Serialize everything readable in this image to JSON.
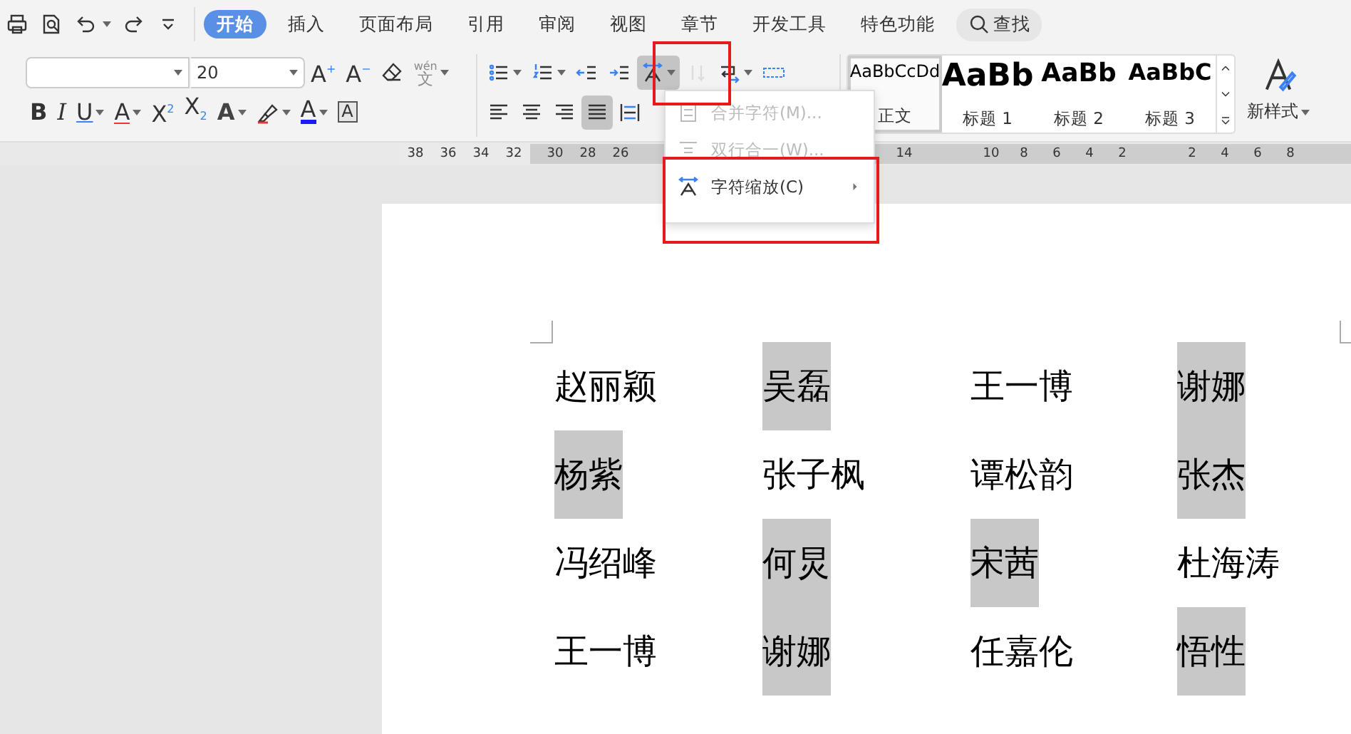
{
  "quick_access": [
    {
      "kind": "print",
      "caret": false
    },
    {
      "kind": "preview",
      "caret": false
    },
    {
      "kind": "undo",
      "caret": true
    },
    {
      "kind": "redo",
      "caret": false
    },
    {
      "kind": "more",
      "caret": false
    }
  ],
  "tabs": [
    {
      "label": "开始",
      "selected": true
    },
    {
      "label": "插入",
      "selected": false
    },
    {
      "label": "页面布局",
      "selected": false
    },
    {
      "label": "引用",
      "selected": false
    },
    {
      "label": "审阅",
      "selected": false
    },
    {
      "label": "视图",
      "selected": false
    },
    {
      "label": "章节",
      "selected": false
    },
    {
      "label": "开发工具",
      "selected": false
    },
    {
      "label": "特色功能",
      "selected": false
    }
  ],
  "search": {
    "label": "查找"
  },
  "ribbon": {
    "font_size": {
      "value": "20"
    },
    "font_row_tools": [
      {
        "kind": "grow",
        "label": "A",
        "mark": "+",
        "caret": false,
        "pressed": false,
        "disabled": false
      },
      {
        "kind": "shrink",
        "label": "A",
        "mark": "−",
        "caret": false,
        "pressed": false,
        "disabled": false
      },
      {
        "kind": "eraser",
        "caret": false,
        "pressed": false,
        "disabled": false
      },
      {
        "kind": "pinyin",
        "label": "文",
        "mark": "wén",
        "caret": true,
        "pressed": false,
        "disabled": true
      }
    ],
    "format_row_tools": [
      {
        "kind": "bold",
        "label": "B",
        "caret": false,
        "pressed": false,
        "disabled": false
      },
      {
        "kind": "italic",
        "label": "I",
        "caret": false,
        "pressed": false,
        "disabled": false
      },
      {
        "kind": "underline",
        "label": "U",
        "caret": true,
        "pressed": false,
        "disabled": false
      },
      {
        "kind": "strike",
        "label": "A",
        "caret": true,
        "pressed": false,
        "disabled": false
      },
      {
        "kind": "superscript",
        "label": "X",
        "mark": "2",
        "caret": false,
        "pressed": false,
        "disabled": false
      },
      {
        "kind": "subscript",
        "label": "X",
        "mark": "2",
        "caret": false,
        "pressed": false,
        "disabled": false
      },
      {
        "kind": "outline",
        "label": "A",
        "caret": true,
        "pressed": false,
        "disabled": false
      },
      {
        "kind": "highlighter",
        "caret": true,
        "pressed": false,
        "disabled": false
      },
      {
        "kind": "fontcolor",
        "label": "A",
        "caret": true,
        "pressed": false,
        "disabled": false
      },
      {
        "kind": "charborder",
        "label": "A",
        "caret": false,
        "pressed": false,
        "disabled": false
      }
    ],
    "paragraph_row_tools": [
      {
        "kind": "bullets",
        "caret": true,
        "pressed": false,
        "disabled": false
      },
      {
        "kind": "numbering",
        "caret": true,
        "pressed": false,
        "disabled": false
      },
      {
        "kind": "outdent",
        "caret": false,
        "pressed": false,
        "disabled": false
      },
      {
        "kind": "indent",
        "caret": false,
        "pressed": false,
        "disabled": false
      },
      {
        "kind": "charscale",
        "caret": true,
        "pressed": true,
        "disabled": false
      },
      {
        "kind": "sort",
        "caret": false,
        "pressed": false,
        "disabled": true
      },
      {
        "kind": "linebreak",
        "caret": true,
        "pressed": false,
        "disabled": false
      },
      {
        "kind": "tableruler",
        "caret": false,
        "pressed": false,
        "disabled": false
      }
    ],
    "align_row_tools": [
      {
        "kind": "alignleft",
        "caret": false,
        "pressed": false,
        "disabled": false
      },
      {
        "kind": "aligncenter",
        "caret": false,
        "pressed": false,
        "disabled": false
      },
      {
        "kind": "alignright",
        "caret": false,
        "pressed": false,
        "disabled": false
      },
      {
        "kind": "justify",
        "caret": false,
        "pressed": true,
        "disabled": false
      },
      {
        "kind": "distribute",
        "caret": false,
        "pressed": false,
        "disabled": false
      }
    ],
    "styles": [
      {
        "kind": "body",
        "sample": "AaBbCcDd",
        "name": "正文",
        "selected": true
      },
      {
        "kind": "h1",
        "sample": "AaBb",
        "name": "标题 1",
        "selected": false
      },
      {
        "kind": "h2",
        "sample": "AaBb",
        "name": "标题 2",
        "selected": false
      },
      {
        "kind": "h3",
        "sample": "AaBbC",
        "name": "标题 3",
        "selected": false
      }
    ],
    "new_style": {
      "label": "新样式"
    }
  },
  "menu": [
    {
      "kind": "combine",
      "label": "合并字符(M)...",
      "disabled": true,
      "submenu": false
    },
    {
      "kind": "twolines",
      "label": "双行合一(W)...",
      "disabled": true,
      "submenu": false
    },
    {
      "kind": "scale",
      "label": "字符缩放(C)",
      "disabled": false,
      "submenu": true
    }
  ],
  "ruler": [
    {
      "labels": [
        "38",
        "36",
        "34",
        "32"
      ],
      "shaded": false
    },
    {
      "labels": [
        "30",
        "28",
        "26"
      ],
      "shaded": true
    },
    {
      "labels": [
        "14"
      ],
      "shaded": true
    },
    {
      "labels": [
        "10",
        "8",
        "6",
        "4",
        "2"
      ],
      "shaded": true
    },
    {
      "labels": [
        "2",
        "4",
        "6",
        "8"
      ],
      "shaded": true
    }
  ],
  "document": {
    "rows": [
      [
        {
          "text": "赵丽颖",
          "highlighted": false
        },
        {
          "text": "吴磊",
          "highlighted": true
        },
        {
          "text": "王一博",
          "highlighted": false
        },
        {
          "text": "谢娜",
          "highlighted": true
        }
      ],
      [
        {
          "text": "杨紫",
          "highlighted": true
        },
        {
          "text": "张子枫",
          "highlighted": false
        },
        {
          "text": "谭松韵",
          "highlighted": false
        },
        {
          "text": "张杰",
          "highlighted": true
        }
      ],
      [
        {
          "text": "冯绍峰",
          "highlighted": false
        },
        {
          "text": "何炅",
          "highlighted": true
        },
        {
          "text": "宋茜",
          "highlighted": true
        },
        {
          "text": "杜海涛",
          "highlighted": false
        }
      ],
      [
        {
          "text": "王一博",
          "highlighted": false
        },
        {
          "text": "谢娜",
          "highlighted": true
        },
        {
          "text": "任嘉伦",
          "highlighted": false
        },
        {
          "text": "悟性",
          "highlighted": true
        }
      ]
    ]
  }
}
